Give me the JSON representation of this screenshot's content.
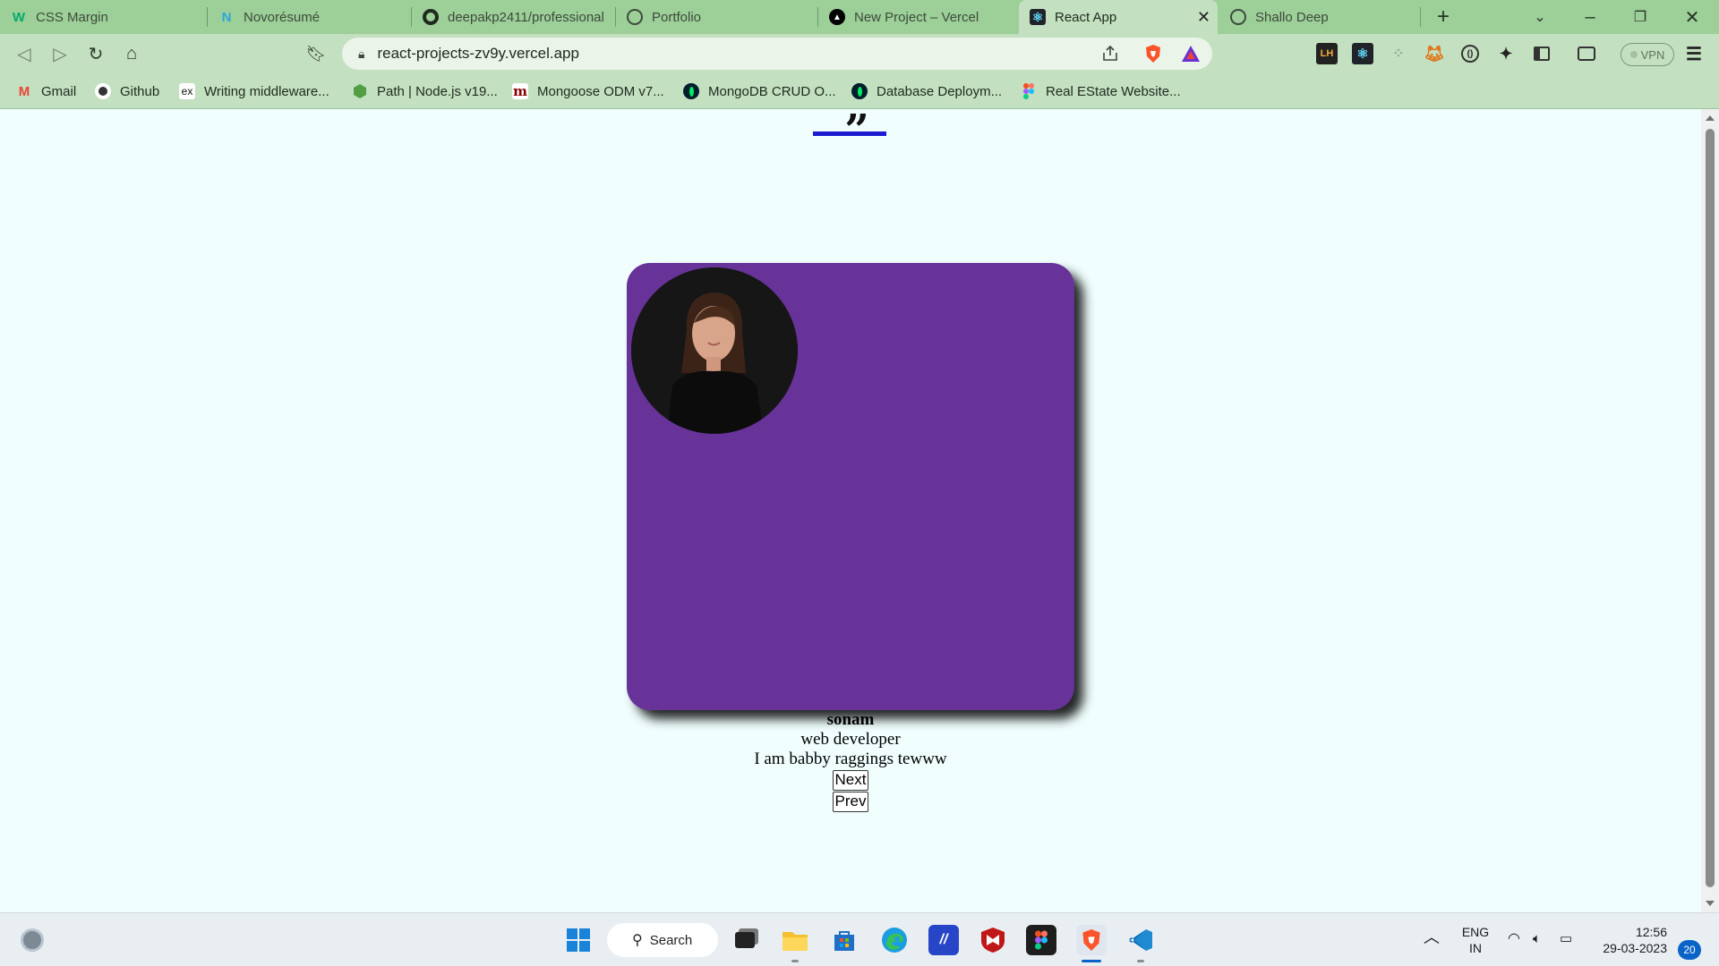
{
  "browser": {
    "tabs": [
      {
        "title": "CSS Margin",
        "icon": "w3schools-icon",
        "icon_text": "W",
        "active": false
      },
      {
        "title": "Novorésumé",
        "icon": "novoresume-icon",
        "icon_text": "N",
        "active": false
      },
      {
        "title": "deepakp2411/professional",
        "icon": "github-icon",
        "icon_text": "",
        "active": false
      },
      {
        "title": "Portfolio",
        "icon": "globe-icon",
        "icon_text": "",
        "active": false
      },
      {
        "title": "New Project – Vercel",
        "icon": "vercel-icon",
        "icon_text": "▲",
        "active": false
      },
      {
        "title": "React App",
        "icon": "react-icon",
        "icon_text": "⚛",
        "active": true
      },
      {
        "title": "Shallo Deep",
        "icon": "globe-icon",
        "icon_text": "",
        "active": false
      }
    ],
    "url": "react-projects-zv9y.vercel.app",
    "vpn_label": "VPN",
    "bookmarks": [
      {
        "label": "Gmail",
        "icon": "gmail-icon",
        "icon_text": "M"
      },
      {
        "label": "Github",
        "icon": "github-icon",
        "icon_text": ""
      },
      {
        "label": "Writing middleware...",
        "icon": "expressjs-icon",
        "icon_text": "ex"
      },
      {
        "label": "Path | Node.js v19...",
        "icon": "nodejs-icon",
        "icon_text": ""
      },
      {
        "label": "Mongoose ODM v7...",
        "icon": "mongoose-icon",
        "icon_text": "m"
      },
      {
        "label": "MongoDB CRUD O...",
        "icon": "mongodb-icon",
        "icon_text": ""
      },
      {
        "label": "Database Deploym...",
        "icon": "mongodb-icon",
        "icon_text": ""
      },
      {
        "label": "Real EState Website...",
        "icon": "figma-icon",
        "icon_text": ""
      }
    ]
  },
  "page": {
    "quote_glyph": "”",
    "person": {
      "name": "sonam",
      "job": "web developer",
      "text": "I am babby raggings tewww"
    },
    "buttons": {
      "next": "Next",
      "prev": "Prev"
    },
    "colors": {
      "card": "#673399",
      "underline": "#1c1cd1",
      "background": "#f0fffe"
    }
  },
  "taskbar": {
    "search_label": "Search",
    "language": "ENG",
    "region": "IN",
    "time": "12:56",
    "date": "29-03-2023",
    "notification_count": "20"
  }
}
